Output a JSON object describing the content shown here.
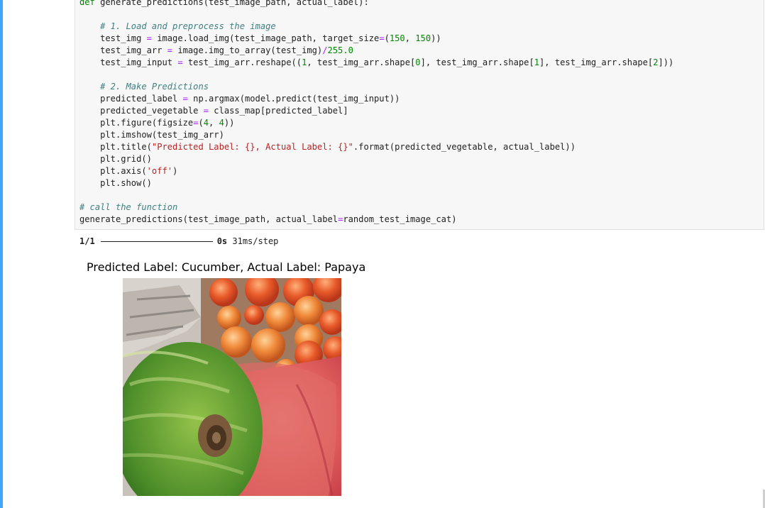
{
  "code_lines": [
    [
      {
        "t": "def ",
        "c": "c-kw"
      },
      {
        "t": "generate_predictions(test_image_path, actual_label):",
        "c": ""
      }
    ],
    [
      {
        "t": "",
        "c": ""
      }
    ],
    [
      {
        "t": "    ",
        "c": ""
      },
      {
        "t": "# 1. Load and preprocess the image",
        "c": "c-comment"
      }
    ],
    [
      {
        "t": "    test_img ",
        "c": ""
      },
      {
        "t": "=",
        "c": "c-op"
      },
      {
        "t": " image.load_img(test_image_path, target_size",
        "c": ""
      },
      {
        "t": "=",
        "c": "c-op"
      },
      {
        "t": "(",
        "c": ""
      },
      {
        "t": "150",
        "c": "c-num"
      },
      {
        "t": ", ",
        "c": ""
      },
      {
        "t": "150",
        "c": "c-num"
      },
      {
        "t": "))",
        "c": ""
      }
    ],
    [
      {
        "t": "    test_img_arr ",
        "c": ""
      },
      {
        "t": "=",
        "c": "c-op"
      },
      {
        "t": " image.img_to_array(test_img)",
        "c": ""
      },
      {
        "t": "/",
        "c": "c-op"
      },
      {
        "t": "255.0",
        "c": "c-num"
      }
    ],
    [
      {
        "t": "    test_img_input ",
        "c": ""
      },
      {
        "t": "=",
        "c": "c-op"
      },
      {
        "t": " test_img_arr.reshape((",
        "c": ""
      },
      {
        "t": "1",
        "c": "c-num"
      },
      {
        "t": ", test_img_arr.shape[",
        "c": ""
      },
      {
        "t": "0",
        "c": "c-num"
      },
      {
        "t": "], test_img_arr.shape[",
        "c": ""
      },
      {
        "t": "1",
        "c": "c-num"
      },
      {
        "t": "], test_img_arr.shape[",
        "c": ""
      },
      {
        "t": "2",
        "c": "c-num"
      },
      {
        "t": "]))",
        "c": ""
      }
    ],
    [
      {
        "t": "",
        "c": ""
      }
    ],
    [
      {
        "t": "    ",
        "c": ""
      },
      {
        "t": "# 2. Make Predictions",
        "c": "c-comment"
      }
    ],
    [
      {
        "t": "    predicted_label ",
        "c": ""
      },
      {
        "t": "=",
        "c": "c-op"
      },
      {
        "t": " np.argmax(model.predict(test_img_input))",
        "c": ""
      }
    ],
    [
      {
        "t": "    predicted_vegetable ",
        "c": ""
      },
      {
        "t": "=",
        "c": "c-op"
      },
      {
        "t": " class_map[predicted_label]",
        "c": ""
      }
    ],
    [
      {
        "t": "    plt.figure(figsize",
        "c": ""
      },
      {
        "t": "=",
        "c": "c-op"
      },
      {
        "t": "(",
        "c": ""
      },
      {
        "t": "4",
        "c": "c-num"
      },
      {
        "t": ", ",
        "c": ""
      },
      {
        "t": "4",
        "c": "c-num"
      },
      {
        "t": "))",
        "c": ""
      }
    ],
    [
      {
        "t": "    plt.imshow(test_img_arr)",
        "c": ""
      }
    ],
    [
      {
        "t": "    plt.title(",
        "c": ""
      },
      {
        "t": "\"Predicted Label: {}, Actual Label: {}\"",
        "c": "c-str"
      },
      {
        "t": ".format(predicted_vegetable, actual_label))",
        "c": ""
      }
    ],
    [
      {
        "t": "    plt.grid()",
        "c": ""
      }
    ],
    [
      {
        "t": "    plt.axis(",
        "c": ""
      },
      {
        "t": "'off'",
        "c": "c-str"
      },
      {
        "t": ")",
        "c": ""
      }
    ],
    [
      {
        "t": "    plt.show()",
        "c": ""
      }
    ],
    [
      {
        "t": "",
        "c": ""
      }
    ],
    [
      {
        "t": "# call the function",
        "c": "c-comment"
      }
    ],
    [
      {
        "t": "generate_predictions(test_image_path, actual_label",
        "c": ""
      },
      {
        "t": "=",
        "c": "c-op"
      },
      {
        "t": "random_test_image_cat)",
        "c": ""
      }
    ]
  ],
  "output": {
    "step": "1/1",
    "time": "0s",
    "rate": "31ms/step"
  },
  "plot": {
    "title": "Predicted Label: Cucumber, Actual Label: Papaya"
  },
  "colors": {
    "accent_bar": "#42a5f5",
    "cell_bg": "#f7f7f7"
  }
}
